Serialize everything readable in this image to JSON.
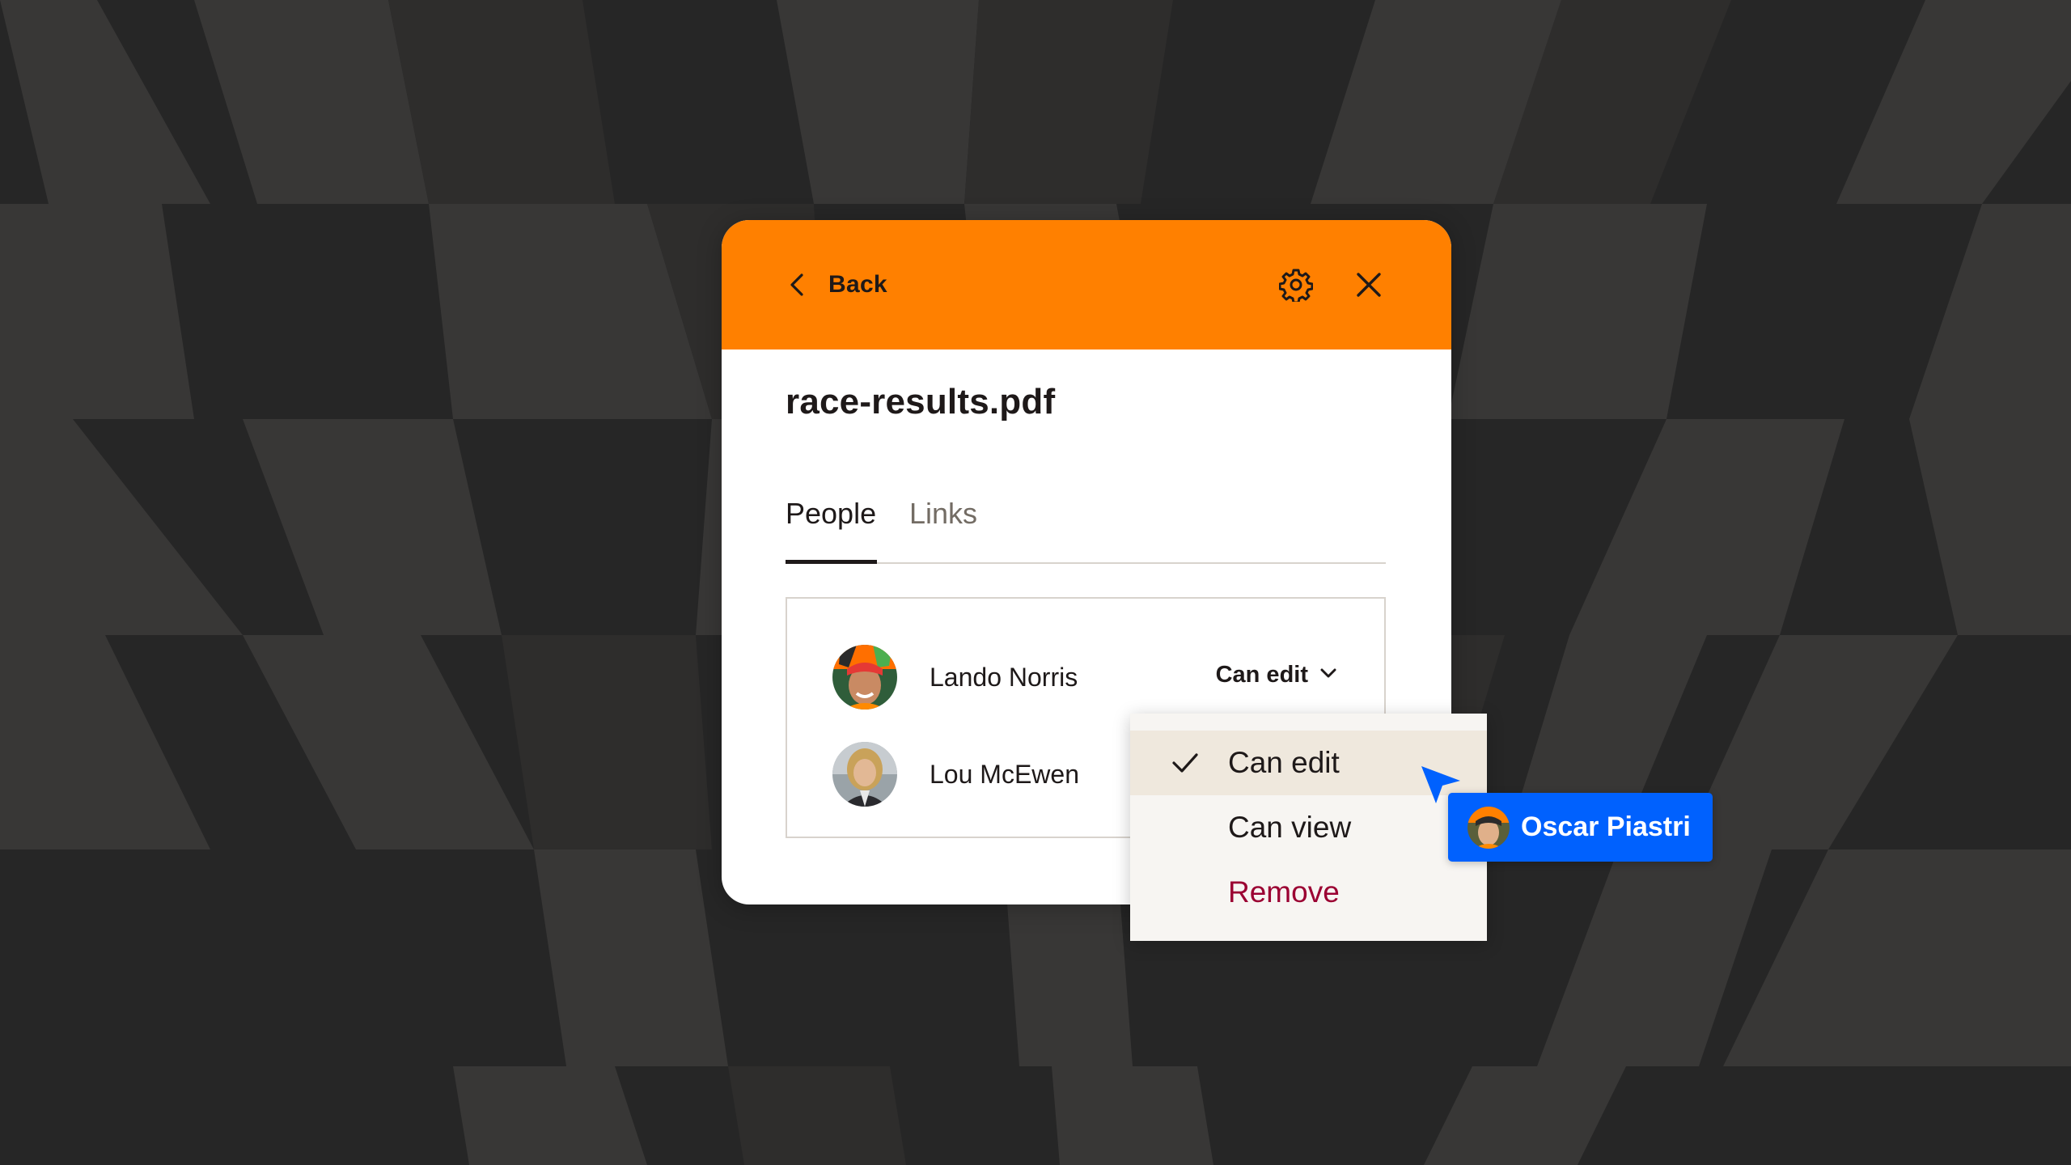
{
  "colors": {
    "background": "#262626",
    "background_stripes": "#3a3938",
    "header": "#ff8000",
    "text": "#1e1919",
    "muted_text": "#736c64",
    "remove": "#9b0032",
    "collaborator_chip": "#0061fe",
    "menu_selected": "#efe8dd"
  },
  "header": {
    "back_label": "Back",
    "back_icon": "chevron-left-icon",
    "settings_icon": "gear-icon",
    "close_icon": "close-icon"
  },
  "file": {
    "name": "race-results.pdf"
  },
  "tabs": [
    {
      "label": "People",
      "active": true
    },
    {
      "label": "Links",
      "active": false
    }
  ],
  "people": [
    {
      "name": "Lando Norris",
      "permission": "Can edit",
      "avatar_icon": "avatar-photo"
    },
    {
      "name": "Lou McEwen",
      "avatar_icon": "avatar-photo"
    }
  ],
  "permission_menu": {
    "items": [
      {
        "label": "Can edit",
        "selected": true
      },
      {
        "label": "Can view",
        "selected": false
      },
      {
        "label": "Remove",
        "selected": false
      }
    ]
  },
  "collaborator": {
    "name": "Oscar Piastri",
    "cursor_icon": "pointer-cursor-icon"
  }
}
